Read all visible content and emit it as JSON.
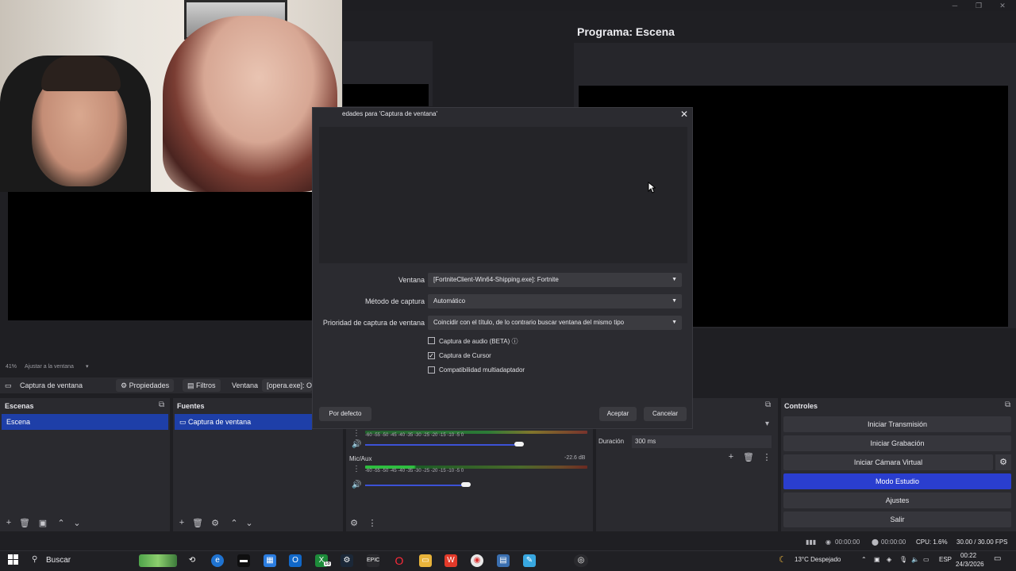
{
  "program": {
    "title": "Programa: Escena"
  },
  "preview": {
    "zoom": "41%",
    "fit_label": "Ajustar a la ventana"
  },
  "source_toolbar": {
    "source_name": "Captura de ventana",
    "properties_label": "Propiedades",
    "filters_label": "Filtros",
    "window_label": "Ventana",
    "window_value": "[opera.exe]: O"
  },
  "docks": {
    "scenes": {
      "title": "Escenas",
      "items": [
        "Escena"
      ]
    },
    "sources": {
      "title": "Fuentes",
      "items": [
        "Captura de ventana"
      ]
    },
    "controls": {
      "title": "Controles",
      "buttons": [
        "Iniciar Transmisión",
        "Iniciar Grabación",
        "Iniciar Cámara Virtual",
        "Modo Estudio",
        "Ajustes",
        "Salir"
      ]
    },
    "transitions": {
      "duration_label": "Duración",
      "duration_value": "300 ms"
    }
  },
  "mixer": {
    "ticks": "-60  -55  -50  -45  -40  -35  -30  -25  -20  -15  -10  -5  0",
    "channels": [
      {
        "name": "Mic/Aux",
        "level": "-22.6 dB",
        "volume_fraction": 0.69
      }
    ],
    "desktop_volume_fraction": 0.9
  },
  "dialog": {
    "title": "edades para 'Captura de ventana'",
    "fields": [
      {
        "label": "Ventana",
        "value": "[FortniteClient-Win64-Shipping.exe]: Fortnite"
      },
      {
        "label": "Método de captura",
        "value": "Automático"
      },
      {
        "label": "Prioridad de captura de ventana",
        "value": "Coincidir con el título, de lo contrario buscar ventana del mismo tipo"
      }
    ],
    "checkboxes": [
      {
        "label": "Captura de audio (BETA)",
        "checked": false
      },
      {
        "label": "Captura de Cursor",
        "checked": true
      },
      {
        "label": "Compatibilidad multiadaptador",
        "checked": false
      }
    ],
    "default_button": "Por defecto",
    "accept_button": "Aceptar",
    "cancel_button": "Cancelar"
  },
  "status": {
    "stream_time": "00:00:00",
    "rec_time": "00:00:00",
    "cpu": "CPU: 1.6%",
    "fps": "30.00 / 30.00 FPS"
  },
  "taskbar": {
    "search_label": "Buscar",
    "weather": "13°C  Despejado",
    "lang": "ESP",
    "time": "00:22",
    "date": "24/3/2026",
    "mail_badge": "18"
  },
  "colors": {
    "accent": "#2a3ecf",
    "selection": "#1e3fa8"
  }
}
